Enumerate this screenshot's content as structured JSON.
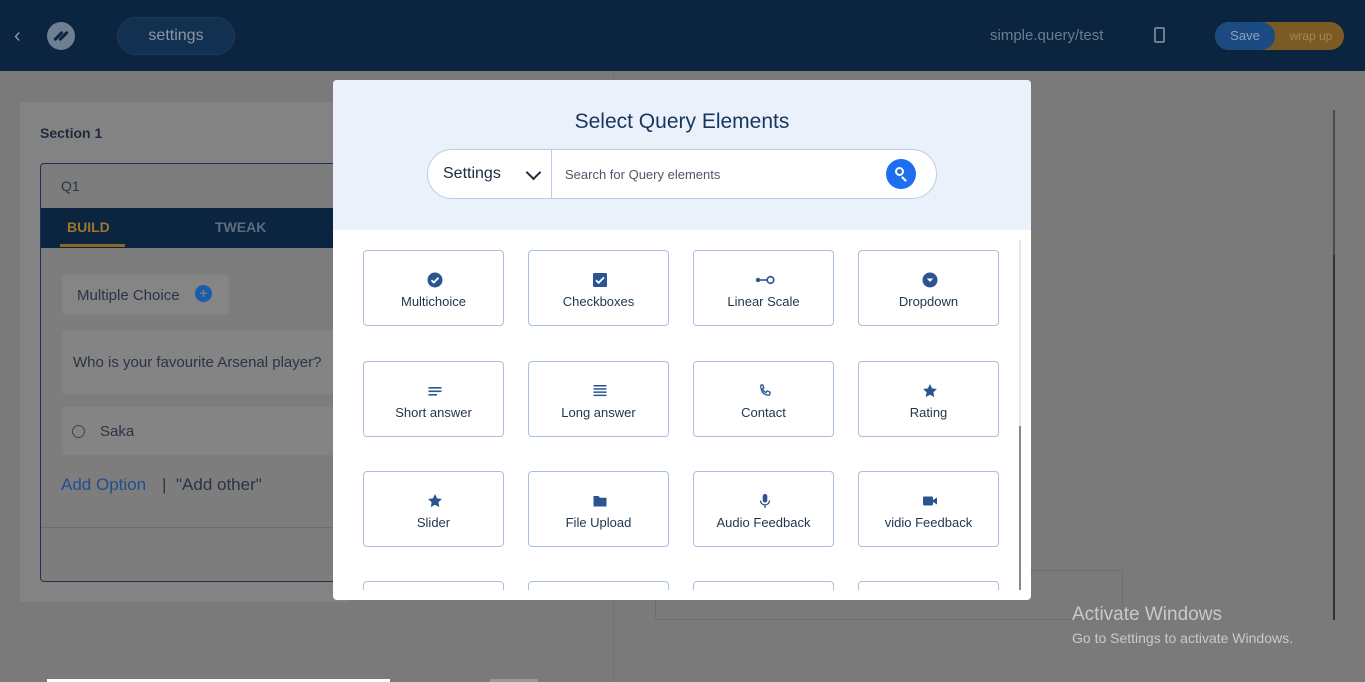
{
  "header": {
    "page_name": "settings",
    "url": "simple.query/test",
    "save_label": "Save",
    "wrap_label": "wrap up"
  },
  "editor": {
    "section_title": "Section 1",
    "question_label": "Q1",
    "tabs": [
      {
        "label": "BUILD"
      },
      {
        "label": "TWEAK"
      }
    ],
    "type_label": "Multiple Choice",
    "question_text": "Who is your favourite Arsenal player?",
    "option_text": "Saka",
    "add_option": "Add Option",
    "separator": "|",
    "add_other": "\"Add other\""
  },
  "modal": {
    "title": "Select Query Elements",
    "filter_value": "Settings",
    "search_placeholder": "Search for Query elements",
    "elements": [
      {
        "label": "Multichoice",
        "icon": "check-circle-icon"
      },
      {
        "label": "Checkboxes",
        "icon": "checkbox-icon"
      },
      {
        "label": "Linear Scale",
        "icon": "linear-scale-icon"
      },
      {
        "label": "Dropdown",
        "icon": "dropdown-circle-icon"
      },
      {
        "label": "Short answer",
        "icon": "short-text-icon"
      },
      {
        "label": "Long answer",
        "icon": "long-text-icon"
      },
      {
        "label": "Contact",
        "icon": "phone-icon"
      },
      {
        "label": "Rating",
        "icon": "star-icon"
      },
      {
        "label": "Slider",
        "icon": "star-icon"
      },
      {
        "label": "File Upload",
        "icon": "folder-icon"
      },
      {
        "label": "Audio Feedback",
        "icon": "microphone-icon"
      },
      {
        "label": "vidio Feedback",
        "icon": "video-camera-icon"
      }
    ]
  },
  "watermark": {
    "title": "Activate Windows",
    "subtitle": "Go to Settings to activate Windows."
  },
  "colors": {
    "header_bg": "#0b2440",
    "accent_blue": "#1e6ff0",
    "icon_color": "#2a5590",
    "card_border": "#a9c0e0"
  }
}
